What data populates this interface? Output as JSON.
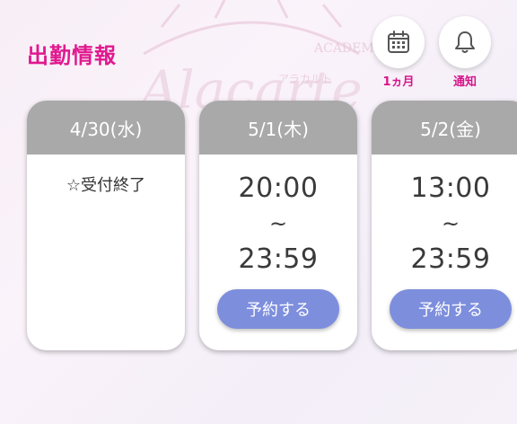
{
  "header": {
    "title": "出勤情報",
    "calendar_label": "1ヵ月",
    "notify_label": "通知"
  },
  "watermark": {
    "logo_text": "Alacarte",
    "sub_text": "ACADEMIE",
    "kana": "アラカルト"
  },
  "days": [
    {
      "date": "4/30(水)",
      "status": "☆受付終了"
    },
    {
      "date": "5/1(木)",
      "start": "20:00",
      "sep": "~",
      "end": "23:59",
      "button": "予約する"
    },
    {
      "date": "5/2(金)",
      "start": "13:00",
      "sep": "~",
      "end": "23:59",
      "button": "予約する"
    }
  ],
  "colors": {
    "title": "#e0198f",
    "card_header": "#a9a9a9",
    "button": "#7d8edd"
  }
}
